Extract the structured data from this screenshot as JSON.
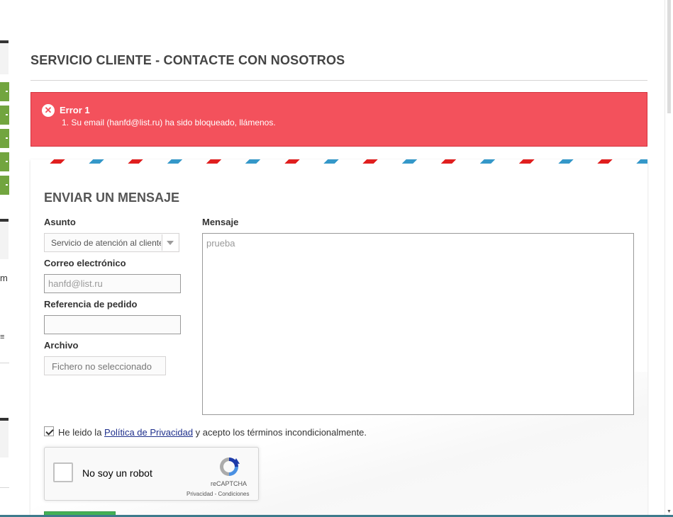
{
  "header": {
    "title": "SERVICIO CLIENTE - CONTACTE CON NOSOTROS"
  },
  "error": {
    "title": "Error 1",
    "message": "1. Su email (hanfd@list.ru) ha sido bloqueado, llámenos.",
    "icon": "close-circle-icon",
    "color": "#f3515c"
  },
  "form": {
    "title": "ENVIAR UN MENSAJE",
    "subject_label": "Asunto",
    "subject_value": "Servicio de atención al cliente",
    "email_label": "Correo electrónico",
    "email_value": "hanfd@list.ru",
    "order_label": "Referencia de pedido",
    "order_value": "",
    "file_label": "Archivo",
    "file_value": "Fichero no seleccionado",
    "message_label": "Mensaje",
    "message_value": "prueba",
    "privacy_prefix": "He leido la ",
    "privacy_link": "Política de Privacidad",
    "privacy_suffix": " y acepto los términos incondicionalmente.",
    "privacy_checked": true
  },
  "captcha": {
    "label": "No soy un robot",
    "brand": "reCAPTCHA",
    "terms": "Privacidad - Condiciones"
  },
  "left_sidebar": {
    "partial_chars": [
      "m",
      "≡"
    ]
  },
  "colors": {
    "accent_green": "#72a53f",
    "submit_green": "#43b155",
    "airmail_blue": "#3598c9",
    "airmail_red": "#e01f1f"
  }
}
